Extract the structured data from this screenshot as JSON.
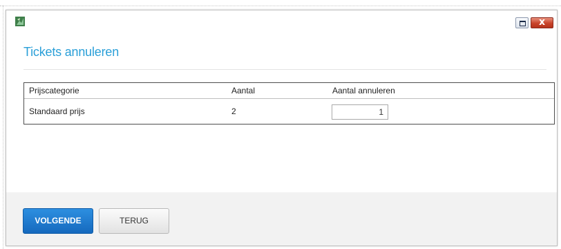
{
  "window": {
    "app_icon": "leaf-app-icon",
    "maximize_icon": "maximize-icon",
    "close_icon": "close-icon",
    "close_glyph": "x",
    "close_color": "#c8432a"
  },
  "page": {
    "title": "Tickets annuleren",
    "title_color": "#2a9fd8"
  },
  "table": {
    "columns": [
      "Prijscategorie",
      "Aantal",
      "Aantal annuleren"
    ],
    "rows": [
      {
        "prijscategorie": "Standaard prijs",
        "aantal": "2",
        "aantal_annuleren": "1"
      }
    ]
  },
  "footer": {
    "next_label": "VOLGENDE",
    "back_label": "TERUG",
    "accent_color": "#1a73c8"
  }
}
